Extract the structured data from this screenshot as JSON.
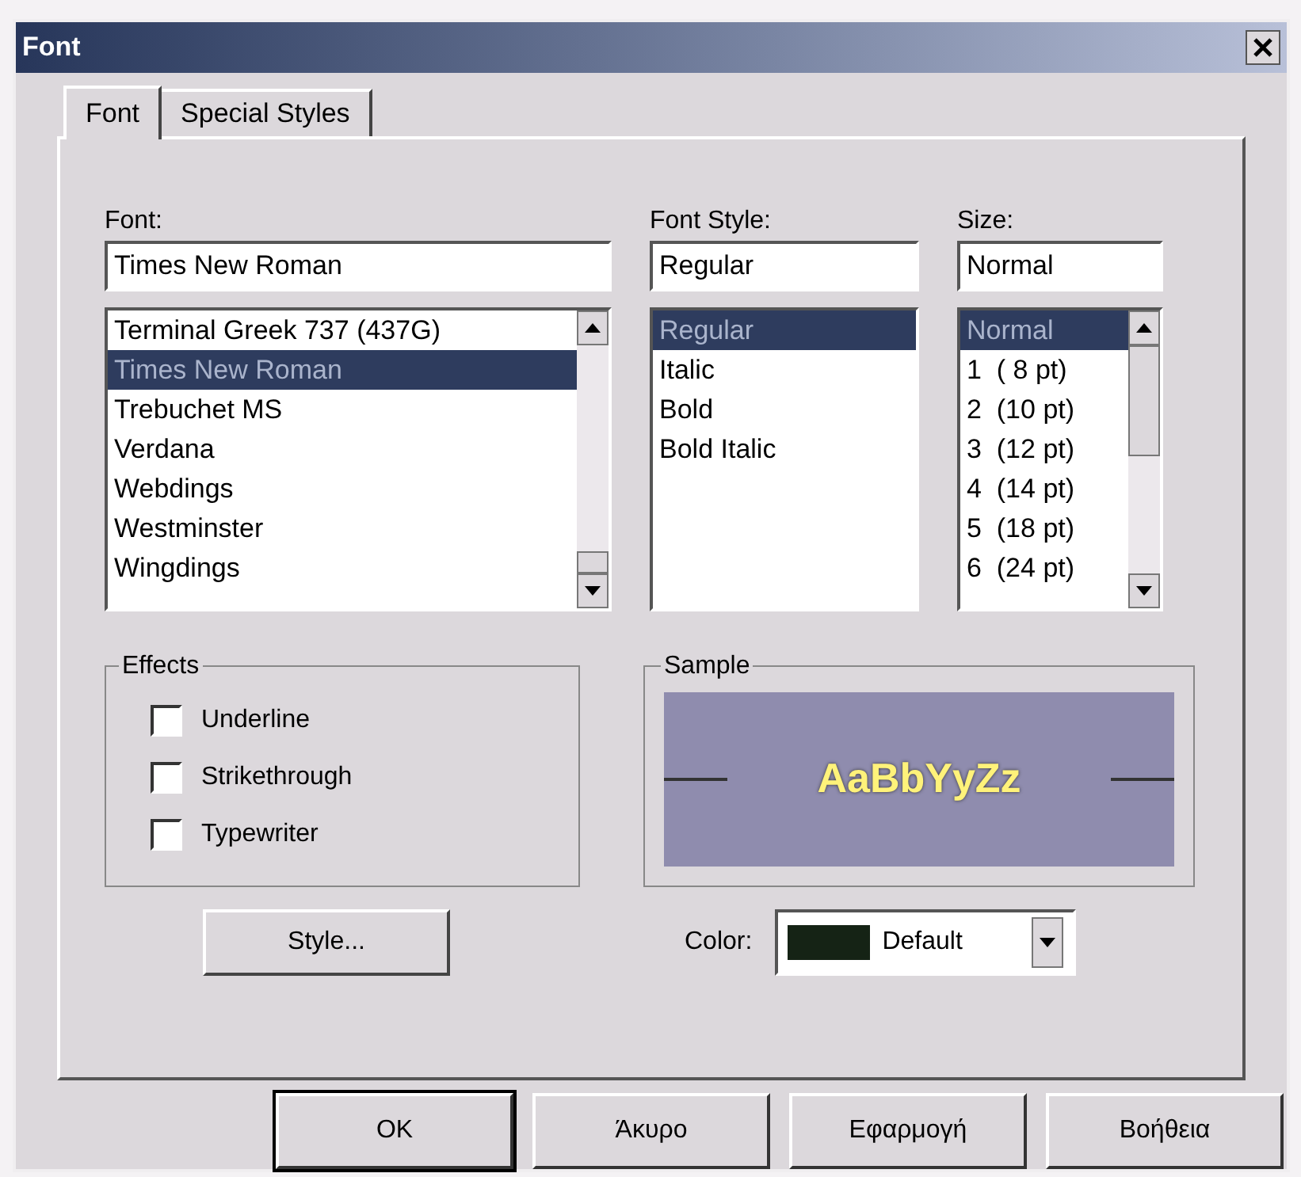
{
  "window": {
    "title": "Font"
  },
  "tabs": [
    {
      "label": "Font",
      "selected": true
    },
    {
      "label": "Special Styles",
      "selected": false
    }
  ],
  "font": {
    "label": "Font:",
    "value": "Times New Roman",
    "items": [
      {
        "label": "Terminal Greek 737 (437G)",
        "selected": false
      },
      {
        "label": "Times New Roman",
        "selected": true
      },
      {
        "label": "Trebuchet MS",
        "selected": false
      },
      {
        "label": "Verdana",
        "selected": false
      },
      {
        "label": "Webdings",
        "selected": false
      },
      {
        "label": "Westminster",
        "selected": false
      },
      {
        "label": "Wingdings",
        "selected": false
      }
    ]
  },
  "font_style": {
    "label": "Font Style:",
    "value": "Regular",
    "items": [
      {
        "label": "Regular",
        "selected": true
      },
      {
        "label": "Italic",
        "selected": false
      },
      {
        "label": "Bold",
        "selected": false
      },
      {
        "label": "Bold Italic",
        "selected": false
      }
    ]
  },
  "size": {
    "label": "Size:",
    "value": "Normal",
    "items": [
      {
        "label": "Normal",
        "selected": true
      },
      {
        "label": "1  ( 8 pt)",
        "selected": false
      },
      {
        "label": "2  (10 pt)",
        "selected": false
      },
      {
        "label": "3  (12 pt)",
        "selected": false
      },
      {
        "label": "4  (14 pt)",
        "selected": false
      },
      {
        "label": "5  (18 pt)",
        "selected": false
      },
      {
        "label": "6  (24 pt)",
        "selected": false
      }
    ]
  },
  "effects": {
    "label": "Effects",
    "options": [
      {
        "label": "Underline",
        "checked": false
      },
      {
        "label": "Strikethrough",
        "checked": false
      },
      {
        "label": "Typewriter",
        "checked": false
      }
    ]
  },
  "sample": {
    "label": "Sample",
    "text": "AaBbYyZz"
  },
  "style_button": "Style...",
  "color": {
    "label": "Color:",
    "value": "Default"
  },
  "buttons": [
    "OK",
    "Άκυρο",
    "Εφαρμογή",
    "Βοήθεια"
  ]
}
